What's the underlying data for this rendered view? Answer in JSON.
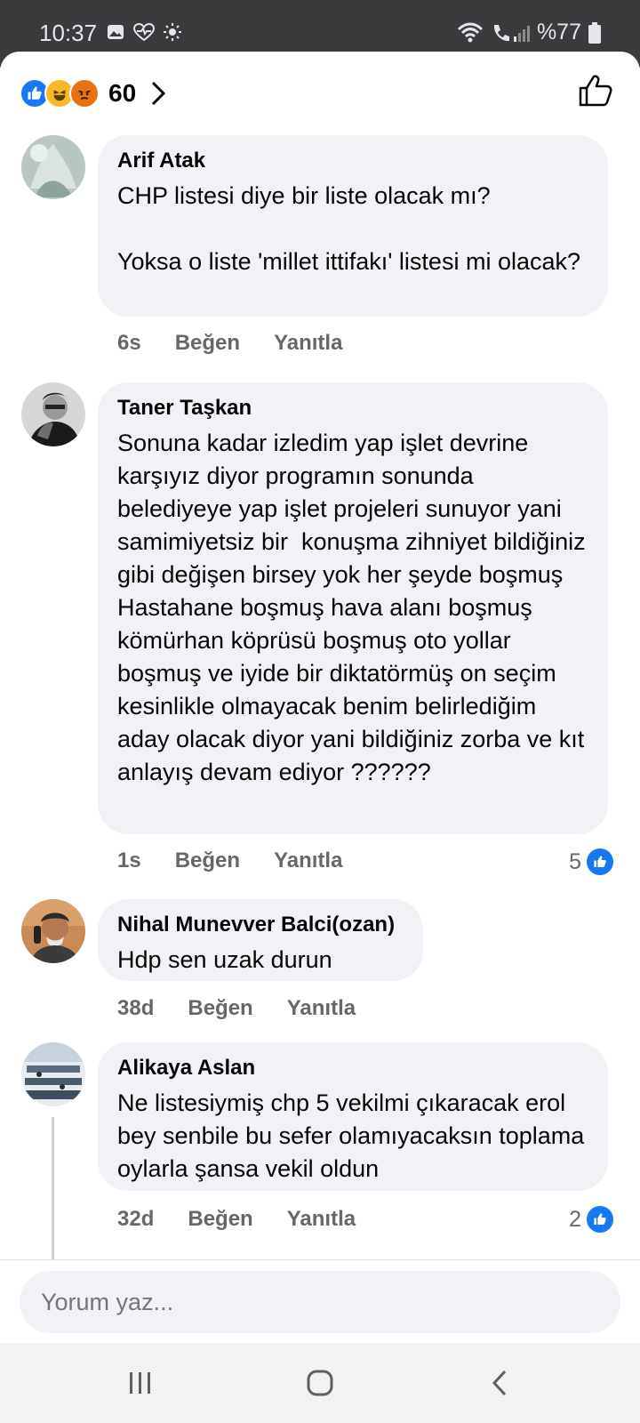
{
  "status_bar": {
    "time": "10:37",
    "battery": "%77",
    "icons": [
      "gallery-icon",
      "health-icon",
      "brightness-icon",
      "wifi-icon",
      "call-signal-icon",
      "battery-icon"
    ]
  },
  "header": {
    "reactions": [
      "like",
      "haha",
      "angry"
    ],
    "reaction_count": "60"
  },
  "comments": [
    {
      "author": "Arif Atak",
      "text": "CHP listesi diye bir liste olacak mı?\n\nYoksa o liste 'millet ittifakı' listesi mi olacak?",
      "time": "6s",
      "like_label": "Beğen",
      "reply_label": "Yanıtla",
      "like_count": ""
    },
    {
      "author": "Taner Taşkan",
      "text": "Sonuna kadar izledim yap işlet devrine karşıyız diyor programın sonunda belediyeye yap işlet projeleri sunuyor yani samimiyetsiz bir  konuşma zihniyet bildiğiniz gibi değişen birsey yok her şeyde boşmuş  Hastahane boşmuş hava alanı boşmuş kömürhan köprüsü boşmuş oto yollar boşmuş ve iyide bir diktatörmüş on seçim kesinlikle olmayacak benim belirlediğim aday olacak diyor yani bildiğiniz zorba ve kıt anlayış devam ediyor ??????",
      "time": "1s",
      "like_label": "Beğen",
      "reply_label": "Yanıtla",
      "like_count": "5"
    },
    {
      "author": "Nihal Munevver Balci(ozan)",
      "text": "Hdp sen uzak durun",
      "time": "38d",
      "like_label": "Beğen",
      "reply_label": "Yanıtla",
      "like_count": ""
    },
    {
      "author": "Alikaya Aslan",
      "text": "Ne listesiymiş chp 5 vekilmi çıkaracak erol bey senbile bu sefer olamıyacaksın toplama oylarla şansa vekil oldun",
      "time": "32d",
      "like_label": "Beğen",
      "reply_label": "Yanıtla",
      "like_count": "2"
    }
  ],
  "composer": {
    "placeholder": "Yorum yaz..."
  },
  "colors": {
    "accent": "#1877f2",
    "bubble": "#f0f2f5",
    "meta_text": "#65676b"
  }
}
